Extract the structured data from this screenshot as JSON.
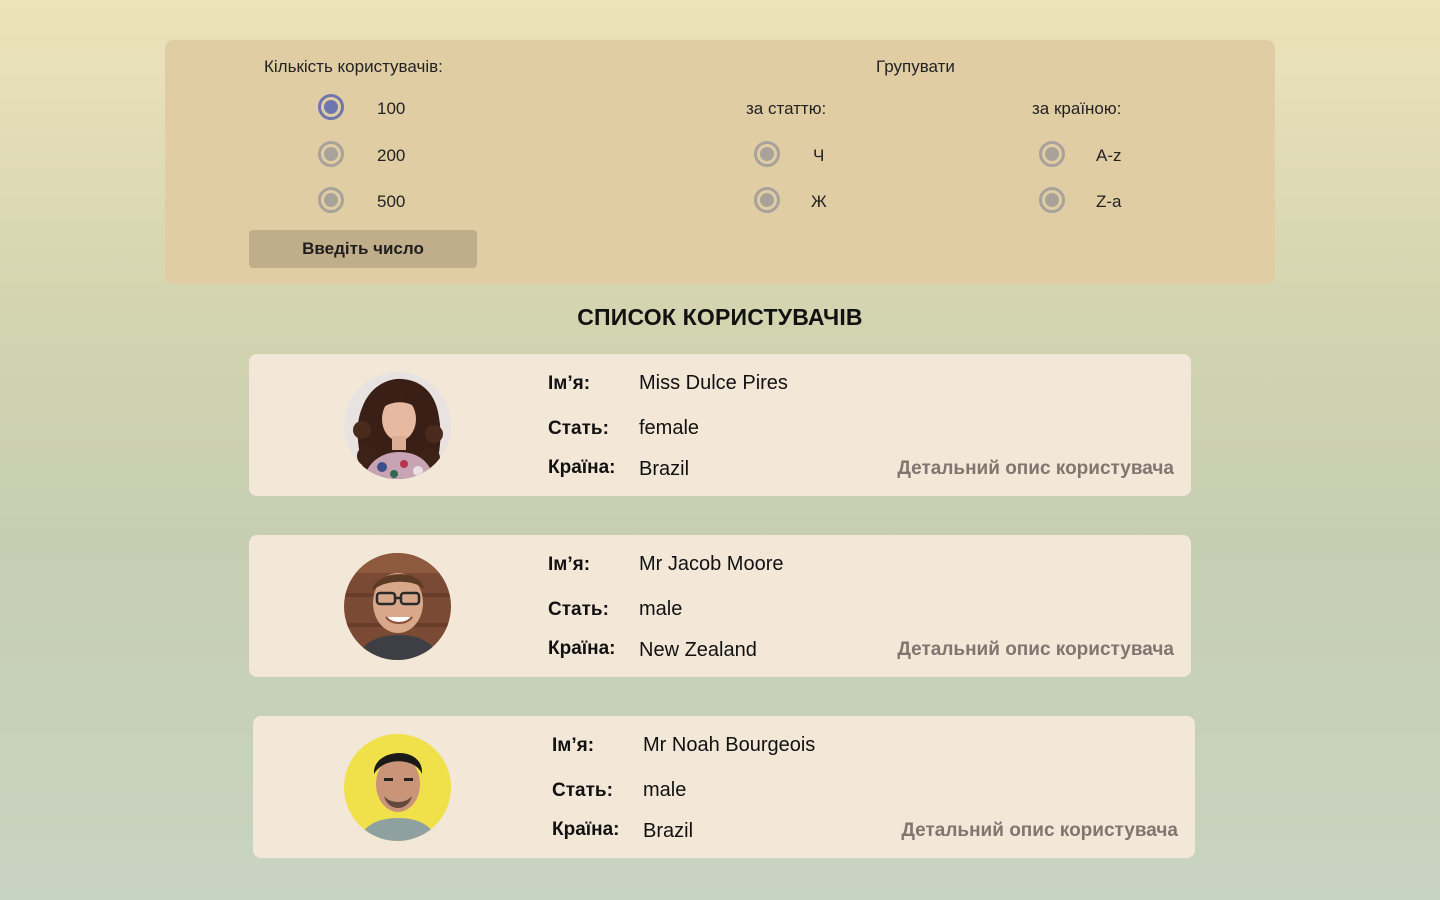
{
  "filters": {
    "count_title": "Кількість користувачів:",
    "count_options": [
      "100",
      "200",
      "500"
    ],
    "selected_count": "100",
    "enter_number_button": "Введіть число",
    "group_title": "Групувати",
    "gender_title": "за статтю:",
    "gender_options": [
      "Ч",
      "Ж"
    ],
    "country_title": "за країною:",
    "country_options": [
      "A-z",
      "Z-a"
    ]
  },
  "list_title": "СПИСОК КОРИСТУВАЧІВ",
  "labels": {
    "name": "Ім’я:",
    "gender": "Стать:",
    "country": "Країна:",
    "detail_link": "Детальний опис користувача"
  },
  "users": [
    {
      "name": "Miss Dulce Pires",
      "gender": "female",
      "country": "Brazil",
      "avatar": "woman-curly-hair-photo"
    },
    {
      "name": "Mr Jacob Moore",
      "gender": "male",
      "country": "New Zealand",
      "avatar": "man-glasses-photo"
    },
    {
      "name": "Mr Noah Bourgeois",
      "gender": "male",
      "country": "Brazil",
      "avatar": "man-yellow-background-photo"
    }
  ],
  "colors": {
    "panel": "#e0cda4",
    "card": "#f3e7d8",
    "radio_checked": "#6f75ad",
    "radio_unchecked": "#a8a29a",
    "link": "#7f7670"
  }
}
